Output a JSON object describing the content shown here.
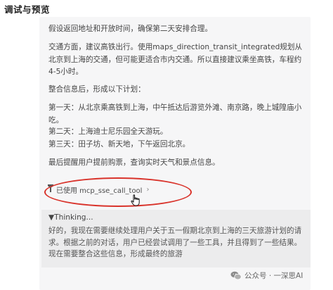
{
  "header": {
    "title": "调试与预览"
  },
  "content": {
    "paragraphs": [
      "假设返回地址和开放时间，确保第二天安排合理。",
      "交通方面，建议高铁出行。使用maps_direction_transit_integrated规划从北京到上海的交通，但可能更适合市内交通。所以直接建议乘坐高铁，车程约4-5小时。",
      "整合信息后，形成以下计划：",
      "第一天：从北京乘高铁到上海，中午抵达后游览外滩、南京路，晚上城隍庙小吃。",
      "第二天：上海迪士尼乐园全天游玩。",
      "第三天：田子坊、新天地，下午返回北京。",
      "最后提醒用户提前购票，查询实时天气和景点信息。"
    ],
    "tool_call": {
      "icon": "tool-icon",
      "label": "已使用 mcp_sse_call_tool",
      "chevron": "›"
    },
    "thinking": {
      "header": "▼Thinking...",
      "body": "好的，我现在需要继续处理用户关于五一假期北京到上海的三天旅游计划的请求。根据之前的对话，用户已经尝试调用了一些工具，并且得到了一些结果。现在需要整合这些信息，形成最终的旅游"
    }
  },
  "annotation": {
    "highlight_color": "#d9332b"
  },
  "watermark": {
    "text": "公众号 · 一深思AI",
    "icon": "wechat-icon"
  }
}
